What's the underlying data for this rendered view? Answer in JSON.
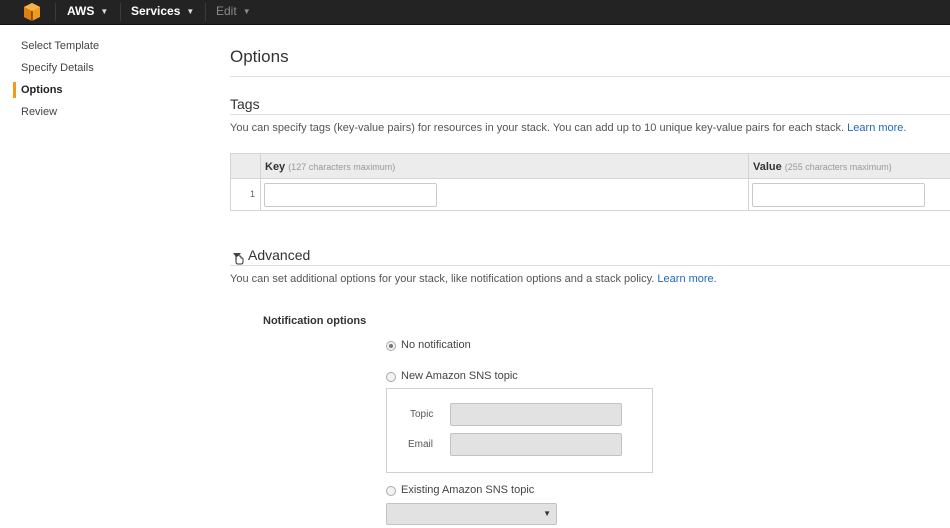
{
  "topbar": {
    "aws_label": "AWS",
    "services_label": "Services",
    "edit_label": "Edit"
  },
  "sidebar": {
    "items": [
      {
        "label": "Select Template"
      },
      {
        "label": "Specify Details"
      },
      {
        "label": "Options"
      },
      {
        "label": "Review"
      }
    ],
    "active": "Options"
  },
  "main": {
    "title": "Options",
    "tags": {
      "title": "Tags",
      "description": "You can specify tags (key-value pairs) for resources in your stack. You can add up to 10 unique key-value pairs for each stack.",
      "learn_more": "Learn more.",
      "key_header": "Key",
      "key_hint": "(127 characters maximum)",
      "value_header": "Value",
      "value_hint": "(255 characters maximum)",
      "rows": [
        {
          "num": "1",
          "key": "",
          "value": ""
        }
      ]
    },
    "advanced": {
      "title": "Advanced",
      "description": "You can set additional options for your stack, like notification options and a stack policy.",
      "learn_more": "Learn more.",
      "notification_label": "Notification options",
      "options": [
        {
          "label": "No notification",
          "checked": true
        },
        {
          "label": "New Amazon SNS topic",
          "checked": false
        },
        {
          "label": "Existing Amazon SNS topic",
          "checked": false
        }
      ],
      "topic_label": "Topic",
      "email_label": "Email",
      "topic_value": "",
      "email_value": "",
      "existing_topic_selected": ""
    }
  },
  "colors": {
    "topbar_bg": "#232323",
    "accent": "#f29a1d",
    "link": "#1e6bb8"
  }
}
